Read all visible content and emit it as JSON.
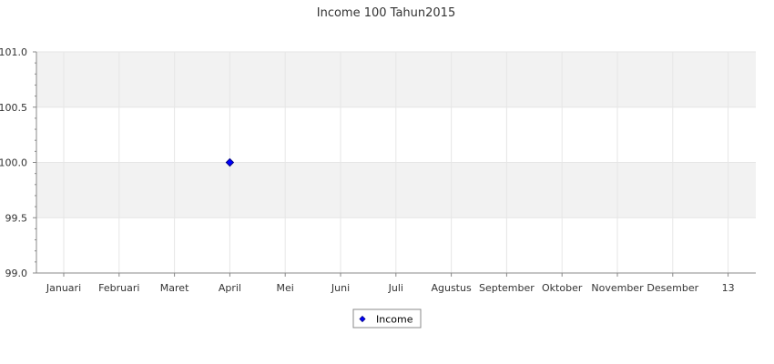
{
  "chart_data": {
    "type": "line",
    "title": "Income 100 Tahun2015",
    "xlabel": "",
    "ylabel": "",
    "categories": [
      "Januari",
      "Februari",
      "Maret",
      "April",
      "Mei",
      "Juni",
      "Juli",
      "Agustus",
      "September",
      "Oktober",
      "November",
      "Desember",
      "13"
    ],
    "series": [
      {
        "name": "Income",
        "points": [
          {
            "category": "April",
            "value": 100.0
          }
        ]
      }
    ],
    "ylim": [
      99.0,
      101.0
    ],
    "y_ticks": [
      "99.0",
      "99.5",
      "100.0",
      "100.5",
      "101.0"
    ],
    "grid": true,
    "legend_position": "bottom",
    "colors": {
      "series": "#0000ff",
      "marker_outline": "#000080",
      "band": "#f2f2f2",
      "grid": "#e6e6e6",
      "axis": "#888888"
    }
  }
}
